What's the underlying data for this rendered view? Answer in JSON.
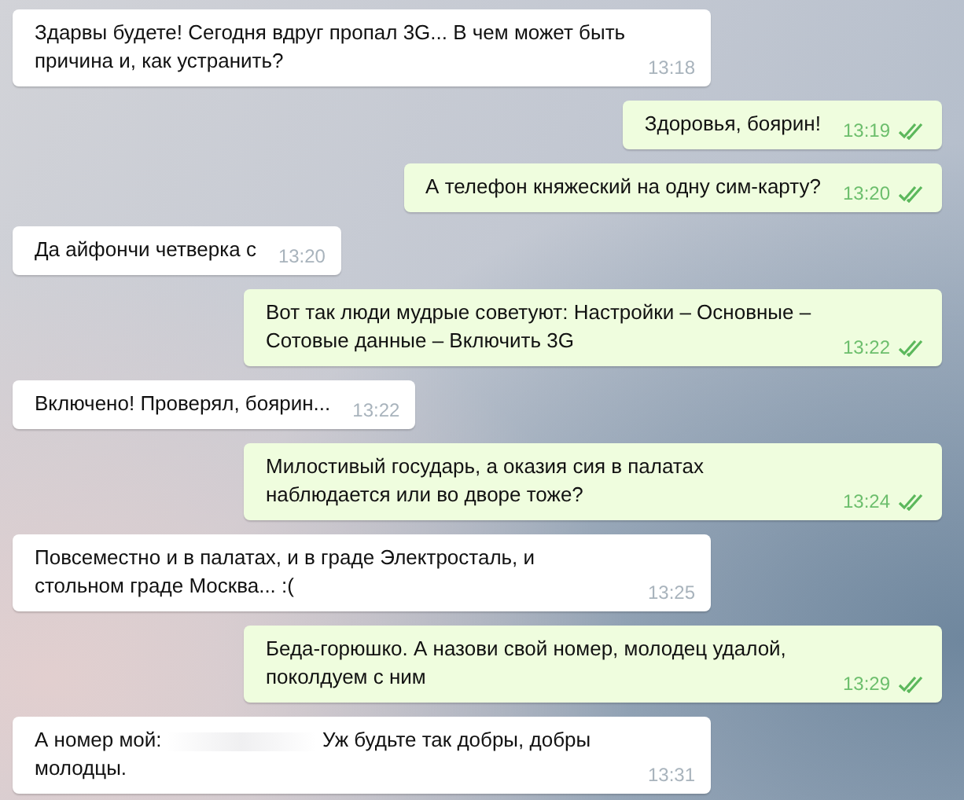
{
  "messages": [
    {
      "kind": "incoming",
      "text": "Здарвы будете! Сегодня вдруг пропал 3G... В чем может быть причина и, как устранить?",
      "time": "13:18"
    },
    {
      "kind": "outgoing",
      "text": "Здоровья, боярин!",
      "time": "13:19",
      "read": true
    },
    {
      "kind": "outgoing",
      "text": "А телефон княжеский на одну сим-карту?",
      "time": "13:20",
      "read": true
    },
    {
      "kind": "incoming",
      "text": "Да айфончи четверка с",
      "time": "13:20"
    },
    {
      "kind": "outgoing",
      "text": "Вот так люди мудрые советуют: Настройки – Основные – Сотовые данные – Включить 3G",
      "time": "13:22",
      "read": true
    },
    {
      "kind": "incoming",
      "text": "Включено! Проверял, боярин...",
      "time": "13:22"
    },
    {
      "kind": "outgoing",
      "text": "Милостивый государь, а оказия сия в палатах наблюдается или во дворе тоже?",
      "time": "13:24",
      "read": true
    },
    {
      "kind": "incoming",
      "text": "Повсеместно и в палатах, и в граде Электросталь, и стольном граде Москва... :(",
      "time": "13:25"
    },
    {
      "kind": "outgoing",
      "text": "Беда-горюшко. А назови свой номер, молодец удалой, поколдуем с ним",
      "time": "13:29",
      "read": true
    },
    {
      "kind": "incoming",
      "text": "А номер мой:",
      "redacted": true,
      "text_after": "Уж будьте так добры, добры молодцы.",
      "time": "13:31"
    }
  ]
}
